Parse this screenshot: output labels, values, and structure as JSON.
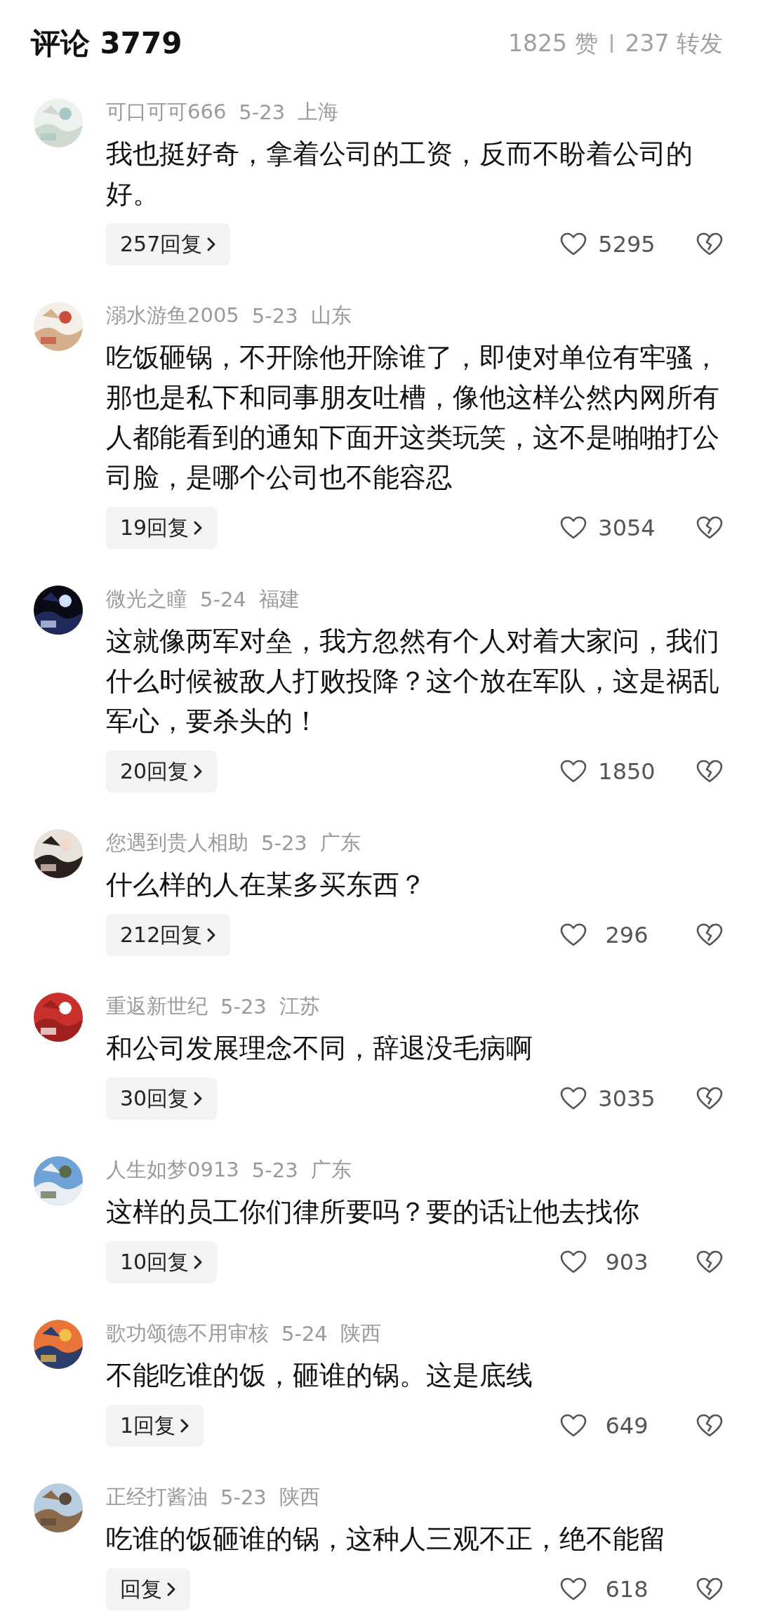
{
  "header": {
    "title": "评论 3779",
    "likes": "1825 赞",
    "shares": "237 转发"
  },
  "comments": [
    {
      "user": "可口可可666",
      "date": "5-23",
      "region": "上海",
      "text": "我也挺好奇，拿着公司的工资，反而不盼着公司的好。",
      "replies": "257回复",
      "likes": "5295"
    },
    {
      "user": "溺水游鱼2005",
      "date": "5-23",
      "region": "山东",
      "text": "吃饭砸锅，不开除他开除谁了，即使对单位有牢骚，那也是私下和同事朋友吐槽，像他这样公然内网所有人都能看到的通知下面开这类玩笑，这不是啪啪打公司脸，是哪个公司也不能容忍",
      "replies": "19回复",
      "likes": "3054"
    },
    {
      "user": "微光之瞳",
      "date": "5-24",
      "region": "福建",
      "text": "这就像两军对垒，我方忽然有个人对着大家问，我们什么时候被敌人打败投降？这个放在军队，这是祸乱军心，要杀头的！",
      "replies": "20回复",
      "likes": "1850"
    },
    {
      "user": "您遇到贵人相助",
      "date": "5-23",
      "region": "广东",
      "text": "什么样的人在某多买东西？",
      "replies": "212回复",
      "likes": "296"
    },
    {
      "user": "重返新世纪",
      "date": "5-23",
      "region": "江苏",
      "text": "和公司发展理念不同，辞退没毛病啊",
      "replies": "30回复",
      "likes": "3035"
    },
    {
      "user": "人生如梦0913",
      "date": "5-23",
      "region": "广东",
      "text": "这样的员工你们律所要吗？要的话让他去找你",
      "replies": "10回复",
      "likes": "903"
    },
    {
      "user": "歌功颂德不用审核",
      "date": "5-24",
      "region": "陕西",
      "text": "不能吃谁的饭，砸谁的锅。这是底线",
      "replies": "1回复",
      "likes": "649"
    },
    {
      "user": "正经打酱油",
      "date": "5-23",
      "region": "陕西",
      "text": "吃谁的饭砸谁的锅，这种人三观不正，绝不能留",
      "replies": "回复",
      "likes": "618"
    }
  ]
}
